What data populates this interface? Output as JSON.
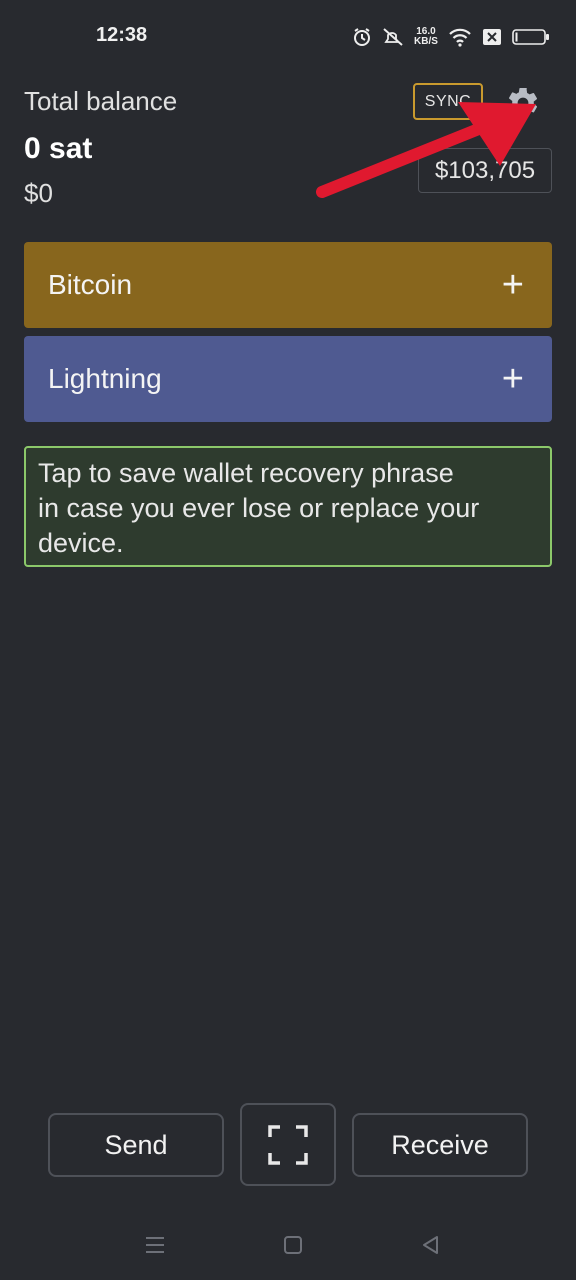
{
  "status_bar": {
    "time": "12:38",
    "net_speed_value": "16.0",
    "net_speed_unit": "KB/S",
    "icons": [
      "alarm-icon",
      "mute-icon",
      "wifi-icon",
      "sim-off-icon",
      "battery-icon"
    ]
  },
  "header": {
    "total_label": "Total balance",
    "sat_balance": "0 sat",
    "usd_balance": "$0",
    "sync_label": "SYNC",
    "btc_price": "$103,705",
    "settings_icon": "gear-icon"
  },
  "wallets": [
    {
      "label": "Bitcoin",
      "color": "#88661d"
    },
    {
      "label": "Lightning",
      "color": "#4f5a91"
    }
  ],
  "backup_notice": {
    "line1": "Tap to save wallet recovery phrase",
    "line2": "in case you ever lose or replace your",
    "line3": "device."
  },
  "actions": {
    "send_label": "Send",
    "receive_label": "Receive",
    "scan_icon": "scan-icon"
  },
  "colors": {
    "background": "#282a2f",
    "sync_border": "#c99a2e",
    "notice_border": "#8cc86a",
    "notice_bg": "#2e3b2e",
    "annotation_arrow": "#e0192f"
  }
}
